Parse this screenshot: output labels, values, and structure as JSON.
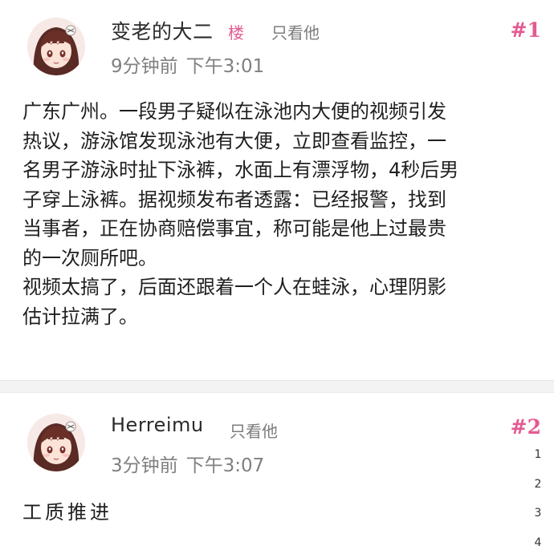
{
  "posts": [
    {
      "username": "变老的大二",
      "op_badge": "楼",
      "only_him": "只看他",
      "relative_time": "9分钟前",
      "time": "下午3:01",
      "floor": "#1",
      "content": "广东广州。一段男子疑似在泳池内大便的视频引发\n热议，游泳馆发现泳池有大便，立即查看监控，一\n名男子游泳时扯下泳裤，水面上有漂浮物，4秒后男\n子穿上泳裤。据视频发布者透露：已经报警，找到\n当事者，正在协商赔偿事宜，称可能是他上过最贵\n的一次厕所吧。\n视频太搞了，后面还跟着一个人在蛙泳，心理阴影\n估计拉满了。",
      "avatar_icon": "anime-girl-avatar"
    },
    {
      "username": "Herreimu",
      "only_him": "只看他",
      "relative_time": "3分钟前",
      "time": "下午3:07",
      "floor": "#2",
      "content": "工质推进",
      "avatar_icon": "anime-girl-avatar"
    }
  ],
  "page_index": [
    "1",
    "2",
    "3",
    "4"
  ],
  "colors": {
    "accent": "#e45a92",
    "meta_text": "#808080",
    "divider": "#f3f3f3"
  }
}
